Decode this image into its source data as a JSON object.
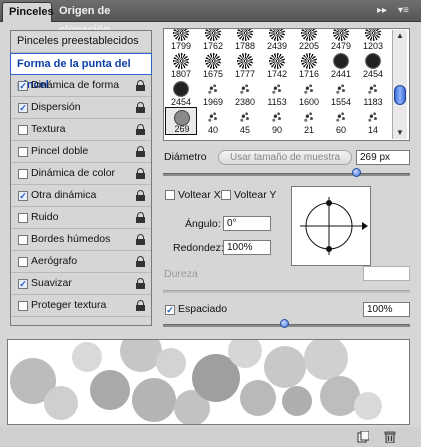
{
  "tabs": [
    {
      "label": "Pinceles"
    },
    {
      "label": "Origen de clonación"
    }
  ],
  "tabbar_controls": {
    "collapse_glyph": "▸▸",
    "menu_glyph": "▾≡"
  },
  "left_list": {
    "header": "Pinceles preestablecidos",
    "selected": "Forma de la punta del pincel",
    "items": [
      {
        "label": "Dinámica de forma",
        "checked": true,
        "check_glyph": "✓"
      },
      {
        "label": "Dispersión",
        "checked": true,
        "check_glyph": "✓"
      },
      {
        "label": "Textura",
        "checked": false,
        "check_glyph": ""
      },
      {
        "label": "Pincel doble",
        "checked": false,
        "check_glyph": ""
      },
      {
        "label": "Dinámica de color",
        "checked": false,
        "check_glyph": ""
      },
      {
        "label": "Otra dinámica",
        "checked": true,
        "check_glyph": "✓"
      },
      {
        "label": "Ruido",
        "checked": false,
        "check_glyph": ""
      },
      {
        "label": "Bordes húmedos",
        "checked": false,
        "check_glyph": ""
      },
      {
        "label": "Aerógrafo",
        "checked": false,
        "check_glyph": ""
      },
      {
        "label": "Suavizar",
        "checked": true,
        "check_glyph": "✓"
      },
      {
        "label": "Proteger textura",
        "checked": false,
        "check_glyph": ""
      }
    ]
  },
  "brushes": [
    {
      "size": "1799",
      "style": "starburst"
    },
    {
      "size": "1762",
      "style": "starburst"
    },
    {
      "size": "1788",
      "style": "starburst"
    },
    {
      "size": "2439",
      "style": "starburst"
    },
    {
      "size": "2205",
      "style": "starburst"
    },
    {
      "size": "2479",
      "style": "starburst"
    },
    {
      "size": "1203",
      "style": "starburst"
    },
    {
      "size": "1807",
      "style": "starburst"
    },
    {
      "size": "1675",
      "style": "starburst"
    },
    {
      "size": "1777",
      "style": "starburst"
    },
    {
      "size": "1742",
      "style": "starburst"
    },
    {
      "size": "1716",
      "style": "starburst"
    },
    {
      "size": "2441",
      "style": "disc"
    },
    {
      "size": "2454",
      "style": "disc"
    },
    {
      "size": "2454",
      "style": "disc"
    },
    {
      "size": "1969",
      "style": "scatter"
    },
    {
      "size": "2380",
      "style": "scatter"
    },
    {
      "size": "1153",
      "style": "scatter"
    },
    {
      "size": "1600",
      "style": "scatter"
    },
    {
      "size": "1554",
      "style": "scatter"
    },
    {
      "size": "1183",
      "style": "scatter"
    },
    {
      "size": "269",
      "style": "gray-disc"
    },
    {
      "size": "40",
      "style": "scatter"
    },
    {
      "size": "45",
      "style": "scatter"
    },
    {
      "size": "90",
      "style": "scatter"
    },
    {
      "size": "21",
      "style": "scatter"
    },
    {
      "size": "60",
      "style": "scatter"
    },
    {
      "size": "14",
      "style": "scatter"
    }
  ],
  "selected_brush_size": "269",
  "diameter": {
    "label": "Diámetro",
    "sample_button": "Usar tamaño de muestra",
    "value": "269 px",
    "slider_fraction": 0.78
  },
  "flip": {
    "x_label": "Voltear X",
    "y_label": "Voltear Y",
    "x_checked": false,
    "y_checked": false
  },
  "angle": {
    "label": "Ángulo:",
    "value": "0°"
  },
  "roundness": {
    "label": "Redondez:",
    "value": "100%"
  },
  "hardness": {
    "label": "Dureza",
    "value": ""
  },
  "spacing": {
    "label": "Espaciado",
    "checked": true,
    "check_glyph": "✓",
    "value": "100%",
    "slider_fraction": 0.49
  },
  "colors": {
    "accent": "#2f63c9",
    "tabbar": "#5f5f5f",
    "panel": "#d6d6d6"
  },
  "icons": [
    "lock-icon",
    "new-brush-icon",
    "trash-icon",
    "panel-menu-icon",
    "collapse-icon"
  ]
}
